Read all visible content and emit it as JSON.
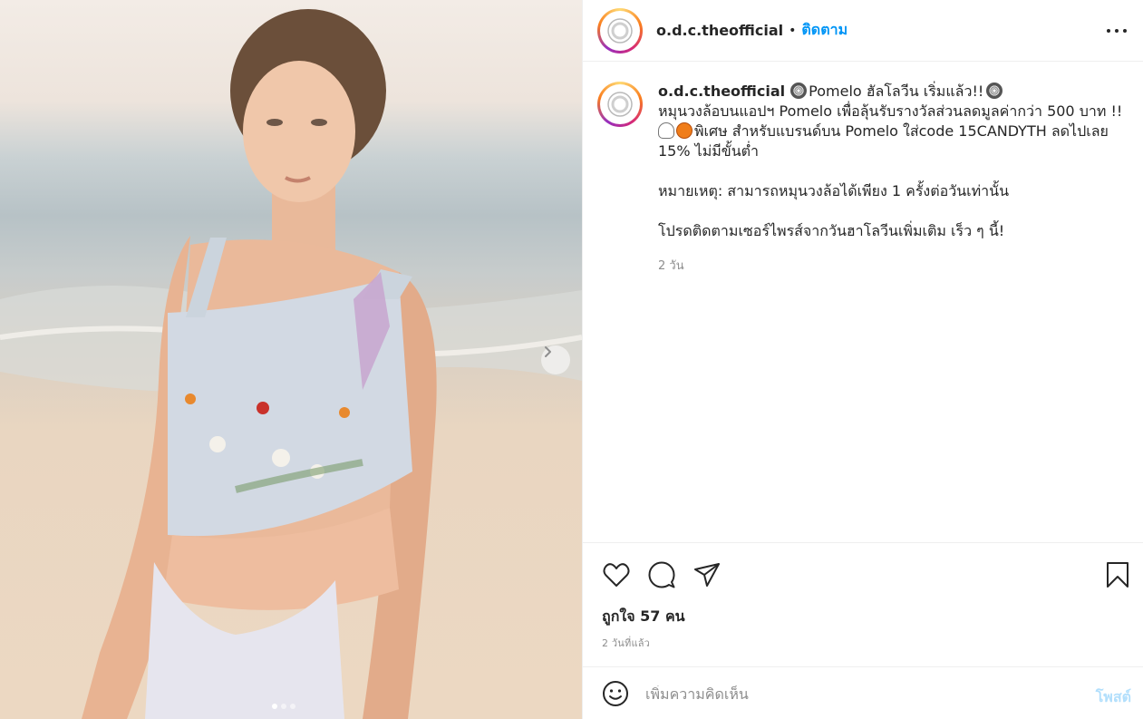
{
  "post": {
    "username": "o.d.c.theofficial",
    "bullet": "•",
    "follow_label": "ติดตาม",
    "more_icon": "more-horizontal-icon"
  },
  "caption": {
    "username": "o.d.c.theofficial",
    "line1": "Pomelo ฮัลโลวีน เริ่มแล้ว!!",
    "line2": "หมุนวงล้อบนแอปฯ Pomelo เพื่อลุ้นรับรางวัลส่วนลดมูลค่ากว่า 500 บาท !!",
    "line3": "พิเศษ สำหรับแบรนด์บน Pomelo ใส่code 15CANDYTH ลดไปเลย",
    "line4": "15% ไม่มีขั้นต่ำ",
    "note": "หมายเหตุ: สามารถหมุนวงล้อได้เพียง 1 ครั้งต่อวันเท่านั้น",
    "follow_more": "โปรดติดตามเซอร์ไพรส์จากวันฮาโลวีนเพิ่มเติม เร็ว ๆ นี้!",
    "time": "2 วัน"
  },
  "actions": {
    "like_icon": "heart-icon",
    "comment_icon": "comment-icon",
    "share_icon": "paper-plane-icon",
    "save_icon": "bookmark-icon",
    "likes_text": "ถูกใจ 57 คน",
    "posted_ago": "2 วันที่แล้ว"
  },
  "comment_box": {
    "emoji_icon": "smiley-icon",
    "placeholder": "เพิ่มความคิดเห็น",
    "post_label": "โพสต์"
  },
  "carousel": {
    "total_slides": 3,
    "active_index": 0,
    "next_icon": "chevron-right-icon"
  },
  "colors": {
    "accent": "#0095f6",
    "post_disabled": "#b2dffc",
    "muted_text": "#8e8e8e",
    "text": "#262626"
  }
}
